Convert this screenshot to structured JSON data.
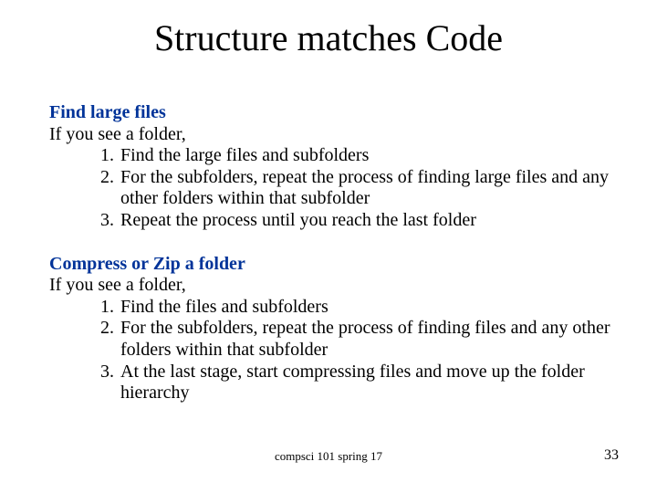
{
  "title": "Structure matches Code",
  "section1": {
    "heading": "Find large files",
    "lead": "If you see a folder,",
    "items": [
      "Find the large files and subfolders",
      "For the subfolders, repeat the process of finding large files and any other folders within that subfolder",
      "Repeat the process until you reach the last folder"
    ]
  },
  "section2": {
    "heading": "Compress or Zip a folder",
    "lead": "If you see a folder,",
    "items": [
      "Find the files and subfolders",
      "For the subfolders, repeat the process of finding files and any other folders within that subfolder",
      "At the last stage, start compressing files and move up the folder hierarchy"
    ]
  },
  "footer": {
    "center": "compsci 101 spring 17",
    "page": "33"
  },
  "nums": {
    "n1": "1.",
    "n2": "2.",
    "n3": "3."
  }
}
